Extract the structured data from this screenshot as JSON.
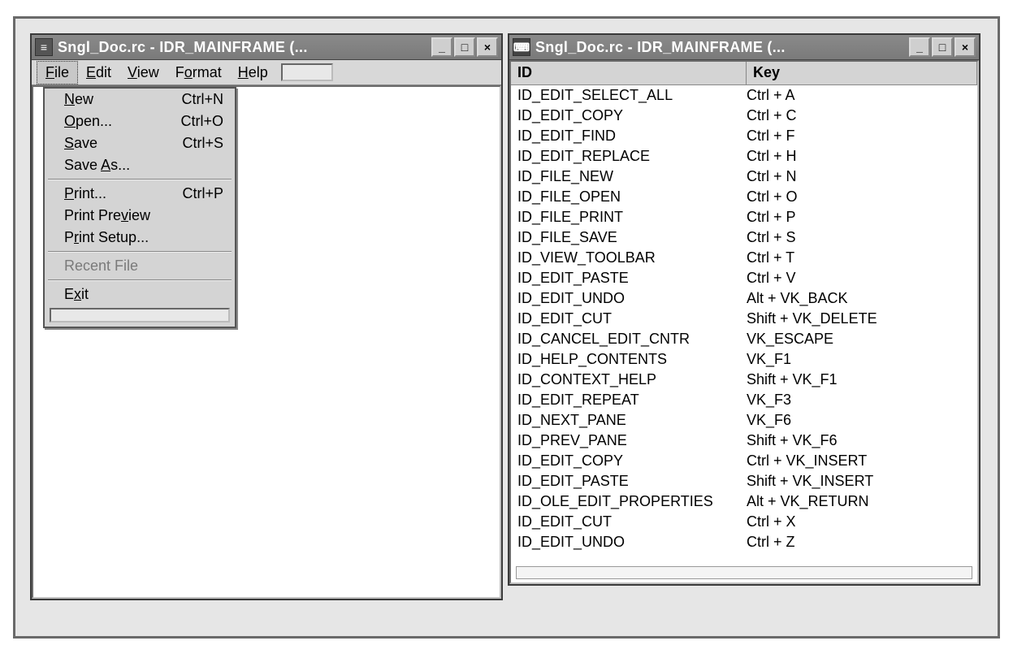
{
  "left_window": {
    "title": "Sngl_Doc.rc - IDR_MAINFRAME (...",
    "menubar": {
      "file": {
        "pre": "",
        "u": "F",
        "post": "ile"
      },
      "edit": {
        "pre": "",
        "u": "E",
        "post": "dit"
      },
      "view": {
        "pre": "",
        "u": "V",
        "post": "iew"
      },
      "format": {
        "pre": "F",
        "u": "o",
        "post": "rmat"
      },
      "help": {
        "pre": "",
        "u": "H",
        "post": "elp"
      }
    },
    "file_menu": {
      "new": {
        "pre": "",
        "u": "N",
        "post": "ew",
        "accel": "Ctrl+N"
      },
      "open": {
        "pre": "",
        "u": "O",
        "post": "pen...",
        "accel": "Ctrl+O"
      },
      "save": {
        "pre": "",
        "u": "S",
        "post": "ave",
        "accel": "Ctrl+S"
      },
      "save_as": {
        "pre": "Save ",
        "u": "A",
        "post": "s...",
        "accel": ""
      },
      "print": {
        "pre": "",
        "u": "P",
        "post": "rint...",
        "accel": "Ctrl+P"
      },
      "print_preview": {
        "pre": "Print Pre",
        "u": "v",
        "post": "iew",
        "accel": ""
      },
      "print_setup": {
        "pre": "P",
        "u": "r",
        "post": "int Setup...",
        "accel": ""
      },
      "recent_file": {
        "label": "Recent File"
      },
      "exit": {
        "pre": "E",
        "u": "x",
        "post": "it",
        "accel": ""
      }
    }
  },
  "right_window": {
    "title": "Sngl_Doc.rc - IDR_MAINFRAME (...",
    "columns": {
      "id": "ID",
      "key": "Key"
    },
    "rows": [
      {
        "id": "ID_EDIT_SELECT_ALL",
        "key": "Ctrl + A"
      },
      {
        "id": "ID_EDIT_COPY",
        "key": "Ctrl + C"
      },
      {
        "id": "ID_EDIT_FIND",
        "key": "Ctrl + F"
      },
      {
        "id": "ID_EDIT_REPLACE",
        "key": "Ctrl + H"
      },
      {
        "id": "ID_FILE_NEW",
        "key": "Ctrl + N"
      },
      {
        "id": "ID_FILE_OPEN",
        "key": "Ctrl + O"
      },
      {
        "id": "ID_FILE_PRINT",
        "key": "Ctrl + P"
      },
      {
        "id": "ID_FILE_SAVE",
        "key": "Ctrl + S"
      },
      {
        "id": "ID_VIEW_TOOLBAR",
        "key": "Ctrl + T"
      },
      {
        "id": "ID_EDIT_PASTE",
        "key": "Ctrl + V"
      },
      {
        "id": "ID_EDIT_UNDO",
        "key": "Alt + VK_BACK"
      },
      {
        "id": "ID_EDIT_CUT",
        "key": "Shift + VK_DELETE"
      },
      {
        "id": "ID_CANCEL_EDIT_CNTR",
        "key": "VK_ESCAPE"
      },
      {
        "id": "ID_HELP_CONTENTS",
        "key": "VK_F1"
      },
      {
        "id": "ID_CONTEXT_HELP",
        "key": "Shift + VK_F1"
      },
      {
        "id": "ID_EDIT_REPEAT",
        "key": "VK_F3"
      },
      {
        "id": "ID_NEXT_PANE",
        "key": "VK_F6"
      },
      {
        "id": "ID_PREV_PANE",
        "key": "Shift + VK_F6"
      },
      {
        "id": "ID_EDIT_COPY",
        "key": "Ctrl + VK_INSERT"
      },
      {
        "id": "ID_EDIT_PASTE",
        "key": "Shift + VK_INSERT"
      },
      {
        "id": "ID_OLE_EDIT_PROPERTIES",
        "key": "Alt + VK_RETURN"
      },
      {
        "id": "ID_EDIT_CUT",
        "key": "Ctrl + X"
      },
      {
        "id": "ID_EDIT_UNDO",
        "key": "Ctrl + Z"
      }
    ]
  },
  "controls": {
    "min": "_",
    "max": "□",
    "close": "×"
  }
}
